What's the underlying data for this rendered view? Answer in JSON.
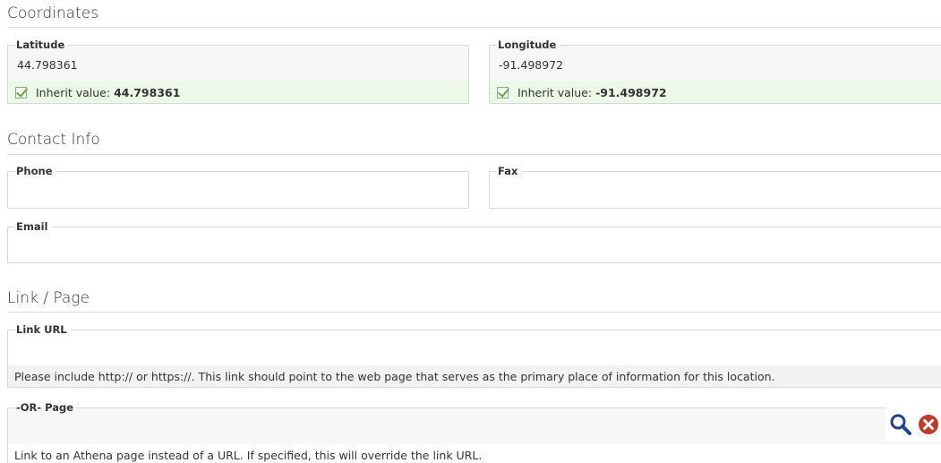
{
  "coordinates": {
    "title": "Coordinates",
    "latitude": {
      "label": "Latitude",
      "value": "44.798361",
      "inherit_label": "Inherit value:",
      "inherit_value": "44.798361"
    },
    "longitude": {
      "label": "Longitude",
      "value": "-91.498972",
      "inherit_label": "Inherit value:",
      "inherit_value": "-91.498972"
    }
  },
  "contact": {
    "title": "Contact Info",
    "phone": {
      "label": "Phone",
      "value": ""
    },
    "fax": {
      "label": "Fax",
      "value": ""
    },
    "email": {
      "label": "Email",
      "value": ""
    }
  },
  "link": {
    "title": "Link / Page",
    "url": {
      "label": "Link URL",
      "value": "",
      "help": "Please include http:// or https://. This link should point to the web page that serves as the primary place of information for this location."
    },
    "page": {
      "label": "-OR- Page",
      "value": "",
      "help": "Link to an Athena page instead of a URL. If specified, this will override the link URL."
    }
  },
  "icons": {
    "search": "search-icon",
    "clear": "clear-icon",
    "check": "checkbox-icon"
  },
  "colors": {
    "inherit_bg": "#ecf8e8",
    "search_icon": "#1f3f8f",
    "clear_icon": "#c0392b"
  }
}
